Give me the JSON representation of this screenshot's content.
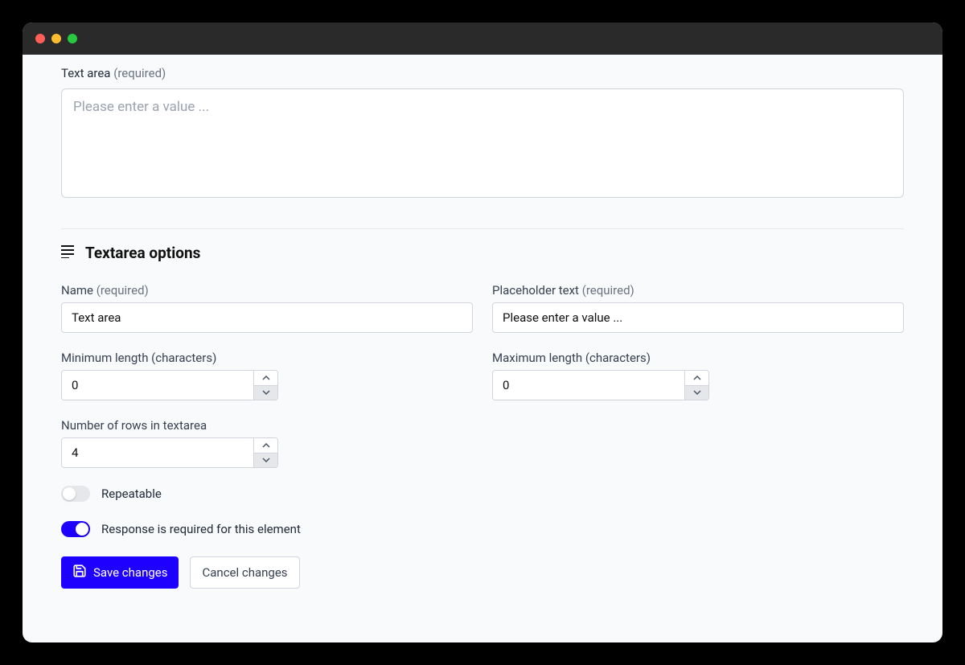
{
  "preview": {
    "label": "Text area",
    "required_tag": "(required)",
    "placeholder": "Please enter a value ..."
  },
  "options": {
    "section_title": "Textarea options",
    "name": {
      "label": "Name",
      "required_tag": "(required)",
      "value": "Text area"
    },
    "placeholder": {
      "label": "Placeholder text",
      "required_tag": "(required)",
      "value": "Please enter a value ..."
    },
    "min_length": {
      "label": "Minimum length (characters)",
      "value": "0"
    },
    "max_length": {
      "label": "Maximum length (characters)",
      "value": "0"
    },
    "rows": {
      "label": "Number of rows in textarea",
      "value": "4"
    },
    "repeatable": {
      "label": "Repeatable",
      "value": false
    },
    "required": {
      "label": "Response is required for this element",
      "value": true
    }
  },
  "buttons": {
    "save": "Save changes",
    "cancel": "Cancel changes"
  }
}
